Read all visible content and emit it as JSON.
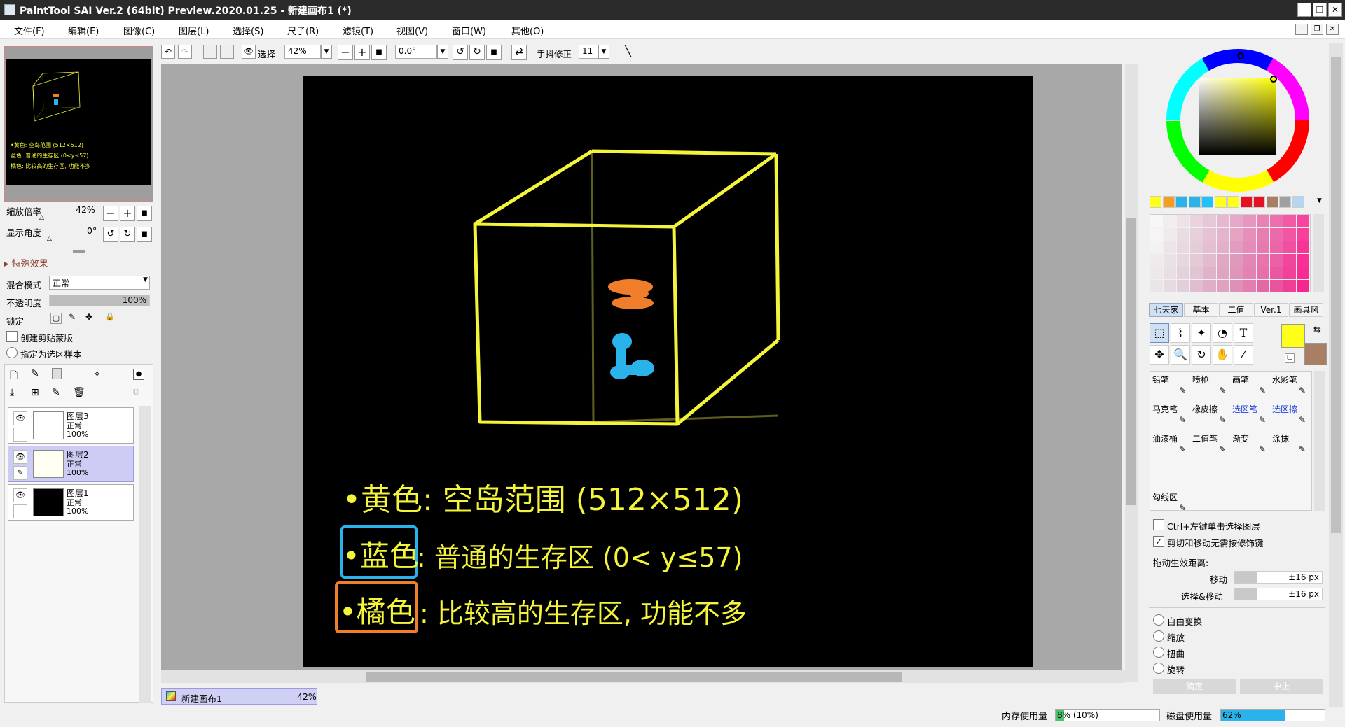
{
  "window": {
    "title": "PaintTool SAI Ver.2 (64bit) Preview.2020.01.25 - 新建画布1 (*)"
  },
  "menu": [
    "文件(F)",
    "编辑(E)",
    "图像(C)",
    "图层(L)",
    "选择(S)",
    "尺子(R)",
    "滤镜(T)",
    "视图(V)",
    "窗口(W)",
    "其他(O)"
  ],
  "toolbar": {
    "select_label": "选择",
    "zoom_value": "42%",
    "rotation_value": "0.0°",
    "stabilizer_label": "手抖修正",
    "stabilizer_value": "11"
  },
  "navigator": {
    "zoom_label": "缩放倍率",
    "zoom_value": "42%",
    "angle_label": "显示角度",
    "angle_value": "0°",
    "thumb_lines": [
      "•黄色: 空岛范围 (512×512)",
      "蓝色: 普通的生存区 (0<y≤57)",
      "橘色: 比较高的生存区, 功能不多"
    ]
  },
  "layer_props": {
    "effects_label": "特殊效果",
    "blend_label": "混合模式",
    "blend_value": "正常",
    "opacity_label": "不透明度",
    "opacity_value": "100%",
    "opacity_fraction": 1.0,
    "lock_label": "锁定",
    "clip_label": "创建剪贴蒙版",
    "selection_source_label": "指定为选区样本"
  },
  "layers": [
    {
      "name": "图层3",
      "mode": "正常",
      "opacity": "100%",
      "selected": false,
      "thumb": "#ffffff"
    },
    {
      "name": "图层2",
      "mode": "正常",
      "opacity": "100%",
      "selected": true,
      "thumb": "#fffff2"
    },
    {
      "name": "图层1",
      "mode": "正常",
      "opacity": "100%",
      "selected": false,
      "thumb": "#000000"
    }
  ],
  "canvas_text": {
    "yellow": "•黄色: 空岛范围 (512×512)",
    "blue_tag": "•蓝色",
    "blue_desc": ": 普通的生存区 (0< y≤57)",
    "orange_tag": "•橘色",
    "orange_desc": ": 比较高的生存区, 功能不多"
  },
  "colors": {
    "yellow": "#f4f43a",
    "blue": "#2ab3ea",
    "orange": "#f07d2a",
    "primary": "#ffff1a",
    "secondary": "#a87f62"
  },
  "doc_tab": {
    "name": "新建画布1",
    "zoom": "42%"
  },
  "palette_swatches": [
    "#ffff1a",
    "#f59d23",
    "#2ab3ea",
    "#2ab3ea",
    "#20c0ff",
    "#ffff1a",
    "#ffff1a",
    "#e81123",
    "#e81123",
    "#a87f62",
    "#a0a0a0",
    "#b5d5f0"
  ],
  "tool_tabs": [
    "七天家",
    "基本",
    "二值",
    "Ver.1",
    "画具风"
  ],
  "brushes": [
    {
      "name": "铅笔",
      "blue": false
    },
    {
      "name": "喷枪",
      "blue": false
    },
    {
      "name": "画笔",
      "blue": false
    },
    {
      "name": "水彩笔",
      "blue": false
    },
    {
      "name": "马克笔",
      "blue": false
    },
    {
      "name": "橡皮擦",
      "blue": false
    },
    {
      "name": "选区笔",
      "blue": true
    },
    {
      "name": "选区擦",
      "blue": true
    },
    {
      "name": "油漆桶",
      "blue": false
    },
    {
      "name": "二值笔",
      "blue": false
    },
    {
      "name": "渐变",
      "blue": false
    },
    {
      "name": "涂抹",
      "blue": false
    },
    {
      "name": "勾线区",
      "blue": false
    }
  ],
  "options": {
    "ctrl_click_label": "Ctrl+左键单击选择图层",
    "ctrl_click_checked": false,
    "cut_move_label": "剪切和移动无需按修饰键",
    "cut_move_checked": true,
    "drag_label": "拖动生效距离:",
    "move_label": "移动",
    "move_value": "±16 px",
    "select_move_label": "选择&移动",
    "select_move_value": "±16 px",
    "transforms": [
      "自由变换",
      "缩放",
      "扭曲",
      "旋转"
    ],
    "ok_label": "确定",
    "cancel_label": "中止"
  },
  "status": {
    "memory_label": "内存使用量",
    "memory_value": "8% (10%)",
    "memory_fraction": 0.08,
    "disk_label": "磁盘使用量",
    "disk_value": "62%",
    "disk_fraction": 0.62
  }
}
